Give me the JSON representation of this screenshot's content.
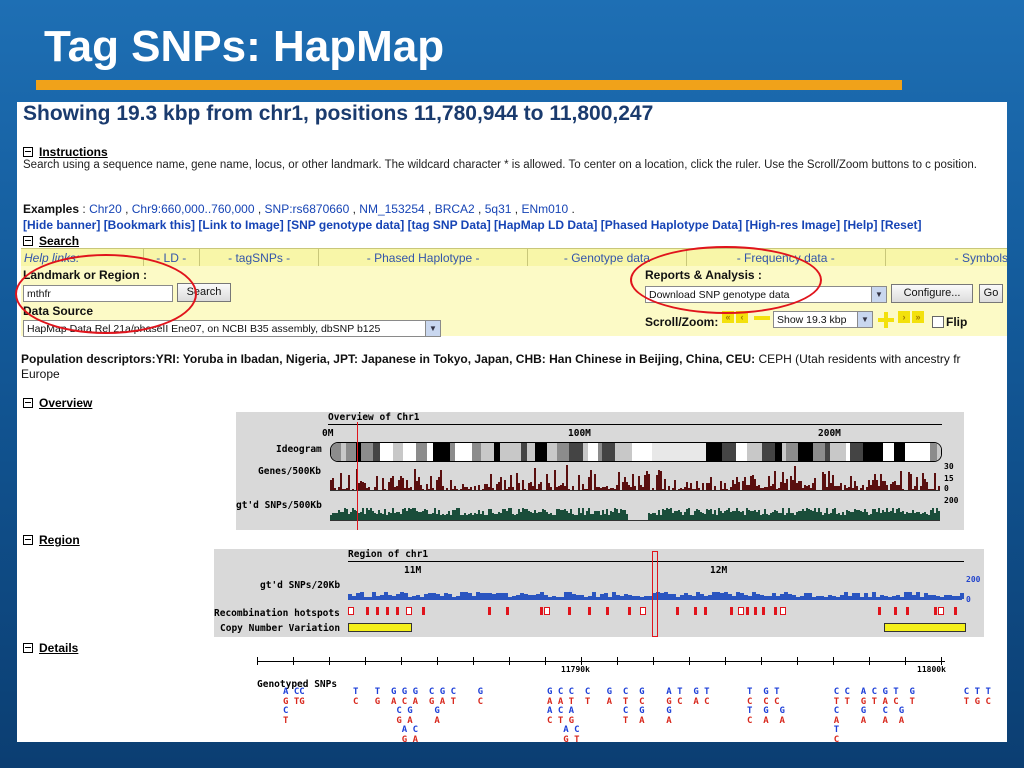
{
  "slide": {
    "title": "Tag SNPs: HapMap"
  },
  "page": {
    "heading": "Showing 19.3 kbp from chr1, positions 11,780,944 to 11,800,247",
    "instructions": {
      "toggle_label": "Instructions",
      "text": "Search using a sequence name, gene name, locus, or other landmark. The wildcard character * is allowed. To center on a location, click the ruler. Use the Scroll/Zoom buttons to c position."
    },
    "examples": {
      "label": "Examples",
      "items": [
        "Chr20",
        "Chr9:660,000..760,000",
        "SNP:rs6870660",
        "NM_153254",
        "BRCA2",
        "5q31",
        "ENm010"
      ]
    },
    "banner_links": [
      "[Hide banner]",
      "[Bookmark this]",
      "[Link to Image]",
      "[SNP genotype data]",
      "[tag SNP Data]",
      "[HapMap LD Data]",
      "[Phased Haplotype Data]",
      "[High-res Image]",
      "[Help]",
      "[Reset]"
    ],
    "search_toggle": "Search",
    "help_links": [
      "Help links:",
      "- LD -",
      "- tagSNPs -",
      "- Phased Haplotype -",
      "- Genotype data",
      "- Frequency data -",
      "- Symbols"
    ],
    "search": {
      "landmark_label": "Landmark or Region",
      "landmark_value": "mthfr",
      "search_button": "Search",
      "data_source_label": "Data Source",
      "data_source_value": "HapMap Data Rel 21a/phaseII Ene07, on NCBI B35 assembly, dbSNP b125"
    },
    "reports": {
      "label": "Reports & Analysis",
      "selected": "Download SNP genotype data",
      "configure_button": "Configure...",
      "go_button": "Go",
      "scroll_zoom_label": "Scroll/Zoom:",
      "zoom_value": "Show 19.3 kbp",
      "flip_label": "Flip"
    },
    "population": {
      "label": "Population descriptors:",
      "text_bold": "YRI: Yoruba in Ibadan, Nigeria, JPT: Japanese in Tokyo, Japan, CHB: Han Chinese in Beijing, China, CEU:",
      "text_plain": " CEPH (Utah residents with ancestry fr",
      "text_cont": "Europe"
    },
    "overview": {
      "toggle_label": "Overview",
      "title": "Overview of Chr1",
      "ticks": [
        "0M",
        "100M",
        "200M"
      ],
      "tracks": [
        "Ideogram",
        "Genes/500Kb",
        "gt'd SNPs/500Kb"
      ],
      "scale_genes": [
        "30",
        "15",
        "0"
      ],
      "scale_snps": "200"
    },
    "region": {
      "toggle_label": "Region",
      "title": "Region of chr1",
      "ticks": [
        "11M",
        "12M"
      ],
      "tracks": [
        "gt'd SNPs/20Kb",
        "Recombination hotspots",
        "Copy Number Variation"
      ],
      "scale": [
        "200",
        "0"
      ]
    },
    "details": {
      "toggle_label": "Details",
      "ticks": [
        "11790k",
        "11800k"
      ],
      "track_label": "Genotyped SNPs"
    }
  },
  "colors": {
    "accent_bar": "#f0a21a",
    "highlight_circle": "#e0141c",
    "link": "#1644b5"
  }
}
